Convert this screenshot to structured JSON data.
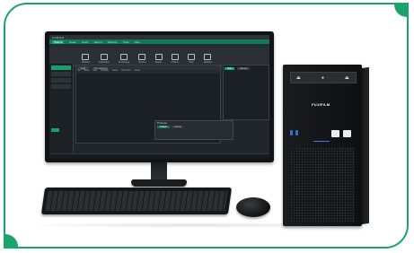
{
  "frame": {
    "accent": "#1aa36b"
  },
  "monitor": {
    "titlebar": {
      "app_name": "FUJIFILM"
    },
    "menubar": {
      "items": [
        "Patient",
        "Exam",
        "Study",
        "Report",
        "Settings",
        "Tools",
        "Help"
      ]
    },
    "toolbar": {
      "items": [
        "Worklist",
        "Acquisition",
        "Processing",
        "Review",
        "Export",
        "Archive",
        "Print",
        "Settings"
      ]
    },
    "main_tabs": [
      "List",
      "Processing"
    ],
    "table_header": [
      "ID",
      "Name",
      "Date",
      "Modality",
      "Status",
      "Body Part",
      "Series"
    ],
    "right_panel_buttons": [
      "Start",
      "Cancel"
    ],
    "processing_panel": {
      "title": "Process",
      "tabs": [
        "Default",
        "Custom"
      ]
    }
  },
  "tower": {
    "brand": "FUJIFILM"
  }
}
